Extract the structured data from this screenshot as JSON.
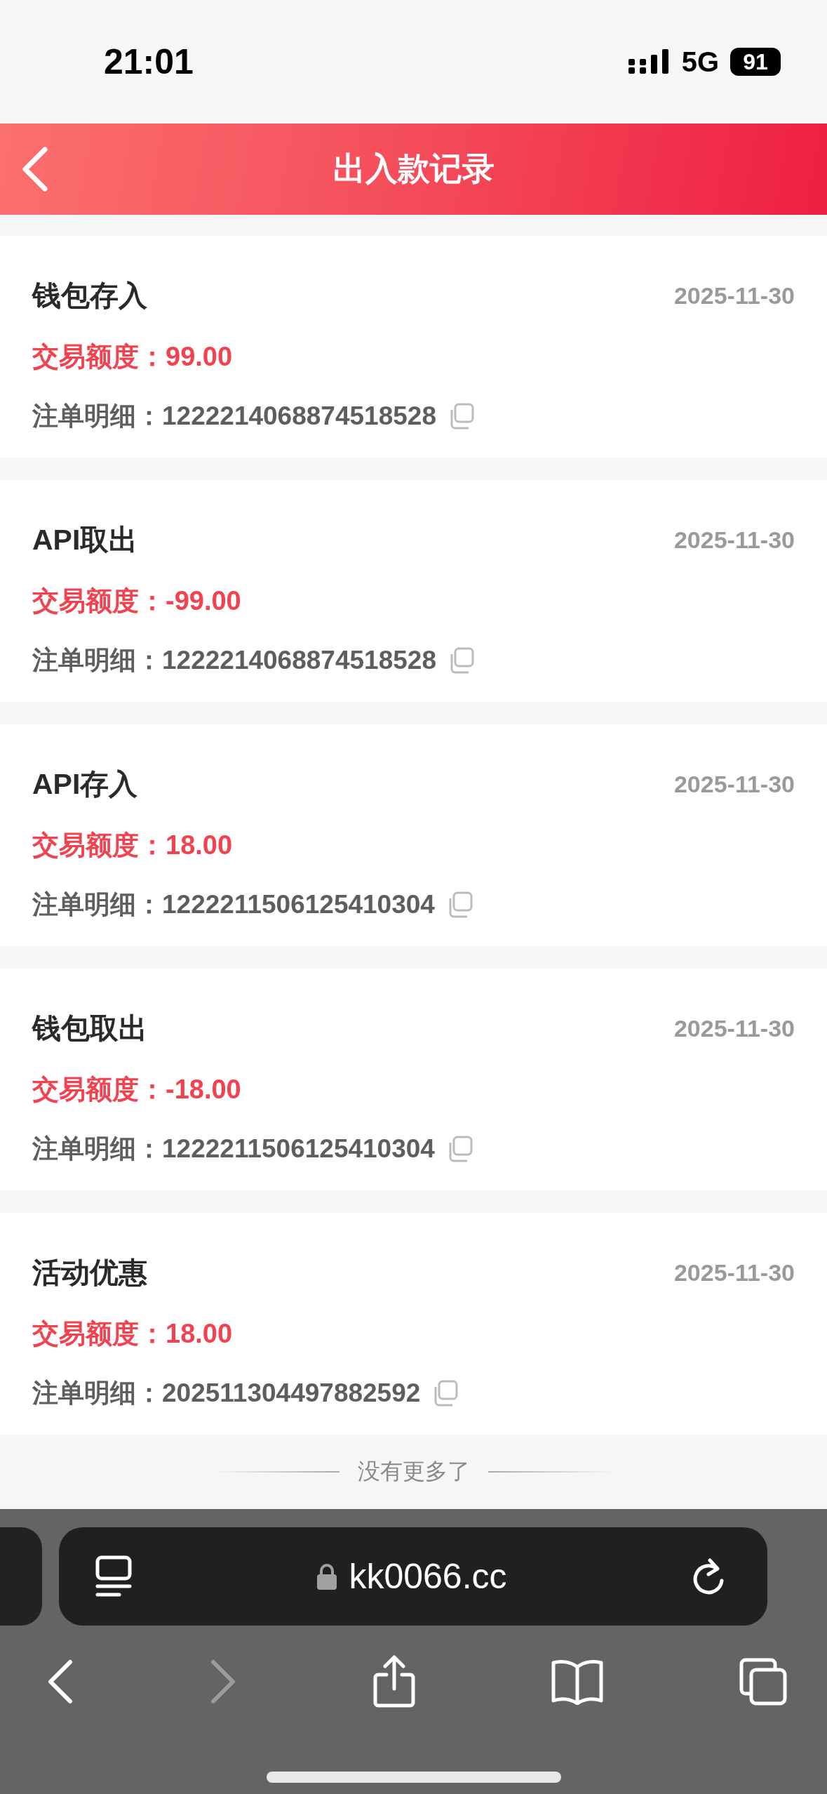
{
  "status_bar": {
    "time": "21:01",
    "network": "5G",
    "battery": "91"
  },
  "header": {
    "title": "出入款记录"
  },
  "records": [
    {
      "title": "钱包存入",
      "date": "2025-11-30",
      "amount_label": "交易额度：",
      "amount": "99.00",
      "detail_label": "注单明细：",
      "detail": "1222214068874518528"
    },
    {
      "title": "API取出",
      "date": "2025-11-30",
      "amount_label": "交易额度：",
      "amount": "-99.00",
      "detail_label": "注单明细：",
      "detail": "1222214068874518528"
    },
    {
      "title": "API存入",
      "date": "2025-11-30",
      "amount_label": "交易额度：",
      "amount": "18.00",
      "detail_label": "注单明细：",
      "detail": "1222211506125410304"
    },
    {
      "title": "钱包取出",
      "date": "2025-11-30",
      "amount_label": "交易额度：",
      "amount": "-18.00",
      "detail_label": "注单明细：",
      "detail": "1222211506125410304"
    },
    {
      "title": "活动优惠",
      "date": "2025-11-30",
      "amount_label": "交易额度：",
      "amount": "18.00",
      "detail_label": "注单明细：",
      "detail": "202511304497882592"
    }
  ],
  "end_note": "没有更多了",
  "browser": {
    "address": "kk0066.cc",
    "toolbar": [
      {
        "kind": "back",
        "disabled": false
      },
      {
        "kind": "forward",
        "disabled": true
      },
      {
        "kind": "share",
        "disabled": false
      },
      {
        "kind": "bookmarks",
        "disabled": false
      },
      {
        "kind": "tabs",
        "disabled": false
      }
    ]
  }
}
